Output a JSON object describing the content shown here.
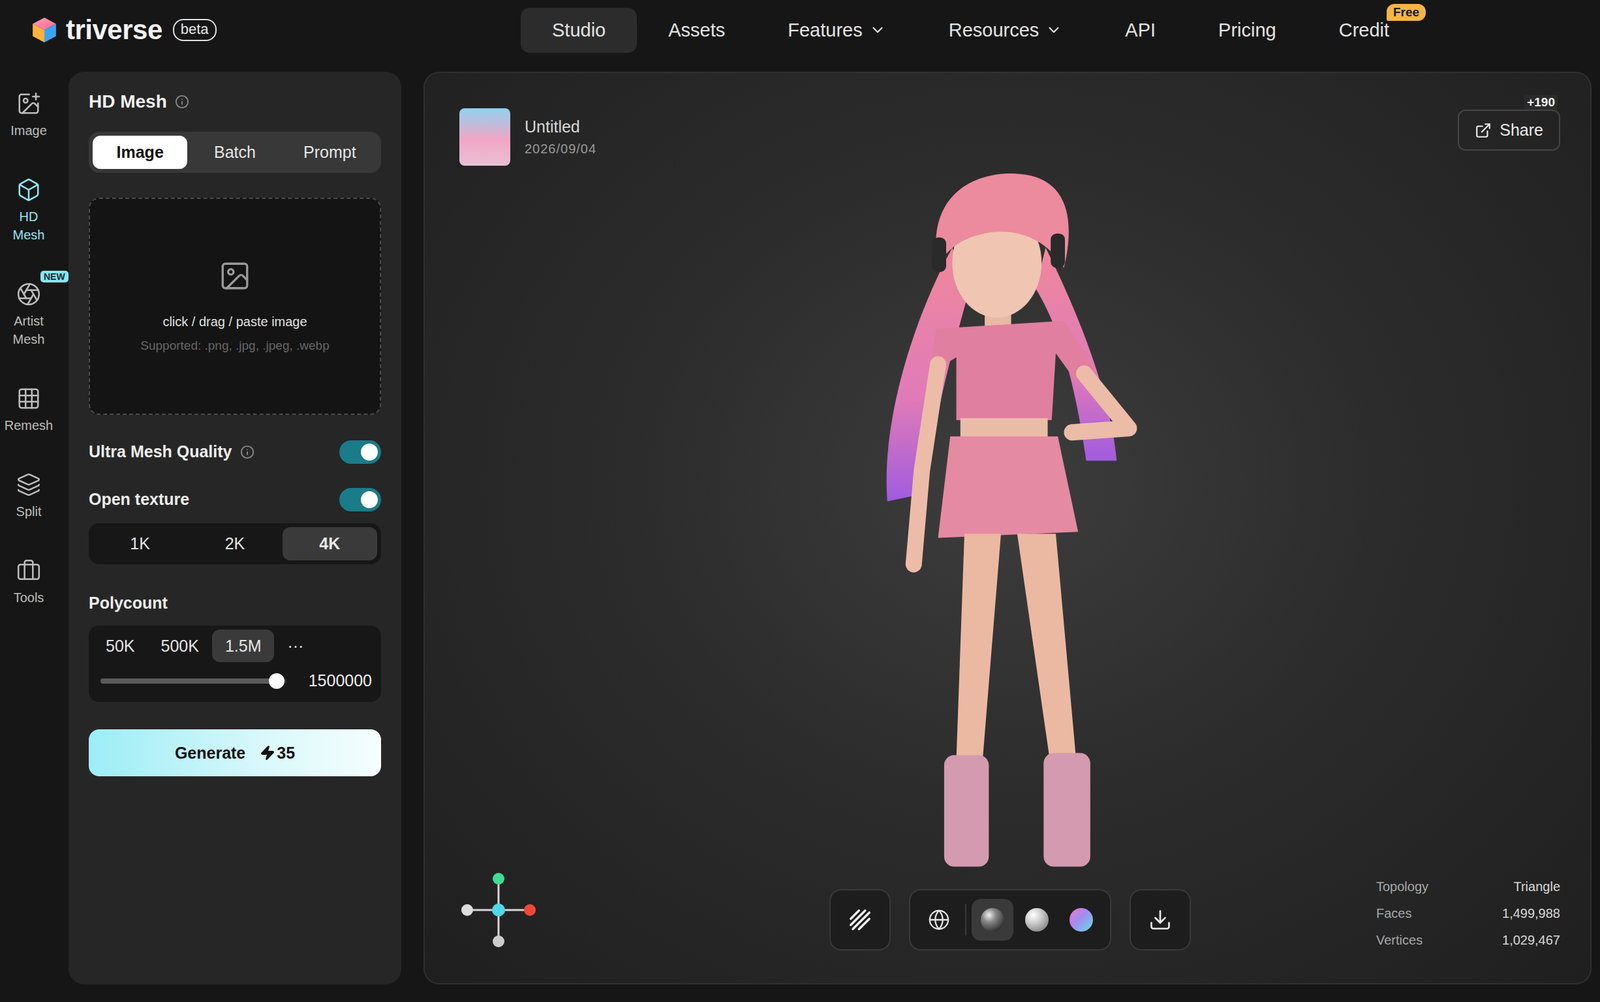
{
  "brand": {
    "name": "triverse",
    "badge": "beta"
  },
  "nav": [
    {
      "label": "Studio",
      "selected": true,
      "dropdown": false,
      "badge": ""
    },
    {
      "label": "Assets",
      "selected": false,
      "dropdown": false,
      "badge": ""
    },
    {
      "label": "Features",
      "selected": false,
      "dropdown": true,
      "badge": ""
    },
    {
      "label": "Resources",
      "selected": false,
      "dropdown": true,
      "badge": ""
    },
    {
      "label": "API",
      "selected": false,
      "dropdown": false,
      "badge": ""
    },
    {
      "label": "Pricing",
      "selected": false,
      "dropdown": false,
      "badge": ""
    },
    {
      "label": "Credit",
      "selected": false,
      "dropdown": false,
      "badge": "Free"
    }
  ],
  "rail": [
    {
      "label": "Image",
      "selected": false,
      "badge": ""
    },
    {
      "label": "HD Mesh",
      "selected": true,
      "badge": ""
    },
    {
      "label": "Artist Mesh",
      "selected": false,
      "badge": "NEW"
    },
    {
      "label": "Remesh",
      "selected": false,
      "badge": ""
    },
    {
      "label": "Split",
      "selected": false,
      "badge": ""
    },
    {
      "label": "Tools",
      "selected": false,
      "badge": ""
    }
  ],
  "panel": {
    "title": "HD Mesh",
    "modes": [
      {
        "label": "Image",
        "selected": true
      },
      {
        "label": "Batch",
        "selected": false
      },
      {
        "label": "Prompt",
        "selected": false
      }
    ],
    "upload": {
      "hint": "click / drag / paste image",
      "formats": "Supported: .png, .jpg, .jpeg, .webp"
    },
    "toggles": [
      {
        "label": "Ultra Mesh Quality",
        "on": true,
        "info": true
      },
      {
        "label": "Open texture",
        "on": true,
        "info": false
      }
    ],
    "resolutions": [
      {
        "label": "1K",
        "selected": false
      },
      {
        "label": "2K",
        "selected": false
      },
      {
        "label": "4K",
        "selected": true
      }
    ],
    "polycount": {
      "label": "Polycount",
      "presets": [
        {
          "label": "50K",
          "selected": false
        },
        {
          "label": "500K",
          "selected": false
        },
        {
          "label": "1.5M",
          "selected": true
        },
        {
          "label": "···",
          "selected": false
        }
      ],
      "level": 0.95,
      "value": "1500000"
    },
    "generate": {
      "label": "Generate",
      "cost": "35"
    }
  },
  "viewer": {
    "title": "Untitled",
    "date": "2026/09/04",
    "share": {
      "label": "Share",
      "badge": "+190"
    },
    "viewModes": [
      {
        "kind": "wireframe",
        "selected": false
      },
      {
        "kind": "globe",
        "selected": false
      },
      {
        "kind": "shaded",
        "selected": true
      },
      {
        "kind": "clay",
        "selected": false
      },
      {
        "kind": "normal",
        "selected": false
      }
    ],
    "stats": [
      {
        "label": "Topology",
        "value": "Triangle"
      },
      {
        "label": "Faces",
        "value": "1,499,988"
      },
      {
        "label": "Vertices",
        "value": "1,029,467"
      }
    ]
  }
}
